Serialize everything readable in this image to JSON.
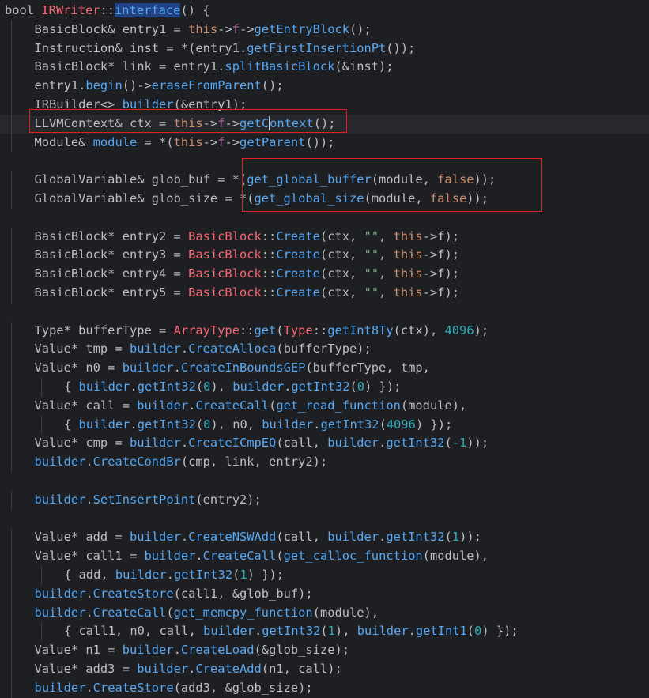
{
  "editor": {
    "lines": [
      [
        [
          "bool ",
          "ty"
        ],
        [
          "IRWriter",
          "red"
        ],
        [
          "::",
          "ty"
        ],
        [
          "interface",
          "fn sel"
        ],
        [
          "() {",
          "ty"
        ]
      ],
      [
        [
          "BasicBlock& entry1 = ",
          "ty"
        ],
        [
          "this",
          "kw"
        ],
        [
          "->",
          "ty"
        ],
        [
          "f",
          "pink"
        ],
        [
          "->",
          "ty"
        ],
        [
          "getEntryBlock",
          "fn"
        ],
        [
          "();",
          "ty"
        ]
      ],
      [
        [
          "Instruction& inst = *(entry1.",
          "ty"
        ],
        [
          "getFirstInsertionPt",
          "fn"
        ],
        [
          "());",
          "ty"
        ]
      ],
      [
        [
          "BasicBlock* link = entry1.",
          "ty"
        ],
        [
          "splitBasicBlock",
          "fn"
        ],
        [
          "(&inst);",
          "ty"
        ]
      ],
      [
        [
          "entry1.",
          "ty"
        ],
        [
          "begin",
          "fn"
        ],
        [
          "()->",
          "ty"
        ],
        [
          "eraseFromParent",
          "fn"
        ],
        [
          "();",
          "ty"
        ]
      ],
      [
        [
          "IRBuilder<> ",
          "ty"
        ],
        [
          "builder",
          "fn"
        ],
        [
          "(&entry1);",
          "ty"
        ]
      ],
      [
        [
          "LLVMContext& ctx = ",
          "ty"
        ],
        [
          "this",
          "kw"
        ],
        [
          "->",
          "ty"
        ],
        [
          "f",
          "pink"
        ],
        [
          "->",
          "ty"
        ],
        [
          "getC",
          "fn"
        ],
        [
          "ontext",
          "fn caret"
        ],
        [
          "();",
          "ty"
        ]
      ],
      [
        [
          "Module& ",
          "ty"
        ],
        [
          "module",
          "fn"
        ],
        [
          " = *(",
          "ty"
        ],
        [
          "this",
          "kw"
        ],
        [
          "->",
          "ty"
        ],
        [
          "f",
          "pink"
        ],
        [
          "->",
          "ty"
        ],
        [
          "getParent",
          "fn"
        ],
        [
          "());",
          "ty"
        ]
      ],
      [],
      [
        [
          "GlobalVariable& glob_buf = *(",
          "ty"
        ],
        [
          "get_global_buffer",
          "fn"
        ],
        [
          "(module, ",
          "ty"
        ],
        [
          "false",
          "kw"
        ],
        [
          "));",
          "ty"
        ]
      ],
      [
        [
          "GlobalVariable& glob_size = *(",
          "ty"
        ],
        [
          "get_global_size",
          "fn"
        ],
        [
          "(module, ",
          "ty"
        ],
        [
          "false",
          "kw"
        ],
        [
          "));",
          "ty"
        ]
      ],
      [],
      [
        [
          "BasicBlock* entry2 = ",
          "ty"
        ],
        [
          "BasicBlock",
          "red"
        ],
        [
          "::",
          "ty"
        ],
        [
          "Create",
          "fn"
        ],
        [
          "(ctx, ",
          "ty"
        ],
        [
          "\"\"",
          "str"
        ],
        [
          ", ",
          "ty"
        ],
        [
          "this",
          "kw"
        ],
        [
          "->f);",
          "ty"
        ]
      ],
      [
        [
          "BasicBlock* entry3 = ",
          "ty"
        ],
        [
          "BasicBlock",
          "red"
        ],
        [
          "::",
          "ty"
        ],
        [
          "Create",
          "fn"
        ],
        [
          "(ctx, ",
          "ty"
        ],
        [
          "\"\"",
          "str"
        ],
        [
          ", ",
          "ty"
        ],
        [
          "this",
          "kw"
        ],
        [
          "->f);",
          "ty"
        ]
      ],
      [
        [
          "BasicBlock* entry4 = ",
          "ty"
        ],
        [
          "BasicBlock",
          "red"
        ],
        [
          "::",
          "ty"
        ],
        [
          "Create",
          "fn"
        ],
        [
          "(ctx, ",
          "ty"
        ],
        [
          "\"\"",
          "str"
        ],
        [
          ", ",
          "ty"
        ],
        [
          "this",
          "kw"
        ],
        [
          "->f);",
          "ty"
        ]
      ],
      [
        [
          "BasicBlock* entry5 = ",
          "ty"
        ],
        [
          "BasicBlock",
          "red"
        ],
        [
          "::",
          "ty"
        ],
        [
          "Create",
          "fn"
        ],
        [
          "(ctx, ",
          "ty"
        ],
        [
          "\"\"",
          "str"
        ],
        [
          ", ",
          "ty"
        ],
        [
          "this",
          "kw"
        ],
        [
          "->f);",
          "ty"
        ]
      ],
      [],
      [
        [
          "Type* bufferType = ",
          "ty"
        ],
        [
          "ArrayType",
          "red"
        ],
        [
          "::",
          "ty"
        ],
        [
          "get",
          "fn"
        ],
        [
          "(",
          "ty"
        ],
        [
          "Type",
          "red"
        ],
        [
          "::",
          "ty"
        ],
        [
          "getInt8Ty",
          "fn"
        ],
        [
          "(ctx), ",
          "ty"
        ],
        [
          "4096",
          "num"
        ],
        [
          ");",
          "ty"
        ]
      ],
      [
        [
          "Value* tmp = ",
          "ty"
        ],
        [
          "builder",
          "fn"
        ],
        [
          ".",
          "ty"
        ],
        [
          "CreateAlloca",
          "fn"
        ],
        [
          "(bufferType);",
          "ty"
        ]
      ],
      [
        [
          "Value* n0 = ",
          "ty"
        ],
        [
          "builder",
          "fn"
        ],
        [
          ".",
          "ty"
        ],
        [
          "CreateInBoundsGEP",
          "fn"
        ],
        [
          "(bufferType, tmp,",
          "ty"
        ]
      ],
      [
        [
          "{ ",
          "ty"
        ],
        [
          "builder",
          "fn"
        ],
        [
          ".",
          "ty"
        ],
        [
          "getInt32",
          "fn"
        ],
        [
          "(",
          "ty"
        ],
        [
          "0",
          "num"
        ],
        [
          "), ",
          "ty"
        ],
        [
          "builder",
          "fn"
        ],
        [
          ".",
          "ty"
        ],
        [
          "getInt32",
          "fn"
        ],
        [
          "(",
          "ty"
        ],
        [
          "0",
          "num"
        ],
        [
          ") });",
          "ty"
        ]
      ],
      [
        [
          "Value* call = ",
          "ty"
        ],
        [
          "builder",
          "fn"
        ],
        [
          ".",
          "ty"
        ],
        [
          "CreateCall",
          "fn"
        ],
        [
          "(",
          "ty"
        ],
        [
          "get_read_function",
          "fn"
        ],
        [
          "(module),",
          "ty"
        ]
      ],
      [
        [
          "{ ",
          "ty"
        ],
        [
          "builder",
          "fn"
        ],
        [
          ".",
          "ty"
        ],
        [
          "getInt32",
          "fn"
        ],
        [
          "(",
          "ty"
        ],
        [
          "0",
          "num"
        ],
        [
          "), n0, ",
          "ty"
        ],
        [
          "builder",
          "fn"
        ],
        [
          ".",
          "ty"
        ],
        [
          "getInt32",
          "fn"
        ],
        [
          "(",
          "ty"
        ],
        [
          "4096",
          "num"
        ],
        [
          ") });",
          "ty"
        ]
      ],
      [
        [
          "Value* cmp = ",
          "ty"
        ],
        [
          "builder",
          "fn"
        ],
        [
          ".",
          "ty"
        ],
        [
          "CreateICmpEQ",
          "fn"
        ],
        [
          "(call, ",
          "ty"
        ],
        [
          "builder",
          "fn"
        ],
        [
          ".",
          "ty"
        ],
        [
          "getInt32",
          "fn"
        ],
        [
          "(",
          "ty"
        ],
        [
          "-1",
          "num"
        ],
        [
          "));",
          "ty"
        ]
      ],
      [
        [
          "builder",
          "fn"
        ],
        [
          ".",
          "ty"
        ],
        [
          "CreateCondBr",
          "fn"
        ],
        [
          "(cmp, link, entry2);",
          "ty"
        ]
      ],
      [],
      [
        [
          "builder",
          "fn"
        ],
        [
          ".",
          "ty"
        ],
        [
          "SetInsertPoint",
          "fn"
        ],
        [
          "(entry2);",
          "ty"
        ]
      ],
      [],
      [
        [
          "Value* add = ",
          "ty"
        ],
        [
          "builder",
          "fn"
        ],
        [
          ".",
          "ty"
        ],
        [
          "CreateNSWAdd",
          "fn"
        ],
        [
          "(call, ",
          "ty"
        ],
        [
          "builder",
          "fn"
        ],
        [
          ".",
          "ty"
        ],
        [
          "getInt32",
          "fn"
        ],
        [
          "(",
          "ty"
        ],
        [
          "1",
          "num"
        ],
        [
          "));",
          "ty"
        ]
      ],
      [
        [
          "Value* call1 = ",
          "ty"
        ],
        [
          "builder",
          "fn"
        ],
        [
          ".",
          "ty"
        ],
        [
          "CreateCall",
          "fn"
        ],
        [
          "(",
          "ty"
        ],
        [
          "get_calloc_function",
          "fn"
        ],
        [
          "(module),",
          "ty"
        ]
      ],
      [
        [
          "{ add, ",
          "ty"
        ],
        [
          "builder",
          "fn"
        ],
        [
          ".",
          "ty"
        ],
        [
          "getInt32",
          "fn"
        ],
        [
          "(",
          "ty"
        ],
        [
          "1",
          "num"
        ],
        [
          ") });",
          "ty"
        ]
      ],
      [
        [
          "builder",
          "fn"
        ],
        [
          ".",
          "ty"
        ],
        [
          "CreateStore",
          "fn"
        ],
        [
          "(call1, &glob_buf);",
          "ty"
        ]
      ],
      [
        [
          "builder",
          "fn"
        ],
        [
          ".",
          "ty"
        ],
        [
          "CreateCall",
          "fn"
        ],
        [
          "(",
          "ty"
        ],
        [
          "get_memcpy_function",
          "fn"
        ],
        [
          "(module),",
          "ty"
        ]
      ],
      [
        [
          "{ call1, n0, call, ",
          "ty"
        ],
        [
          "builder",
          "fn"
        ],
        [
          ".",
          "ty"
        ],
        [
          "getInt32",
          "fn"
        ],
        [
          "(",
          "ty"
        ],
        [
          "1",
          "num"
        ],
        [
          "), ",
          "ty"
        ],
        [
          "builder",
          "fn"
        ],
        [
          ".",
          "ty"
        ],
        [
          "getInt1",
          "fn"
        ],
        [
          "(",
          "ty"
        ],
        [
          "0",
          "num"
        ],
        [
          ") });",
          "ty"
        ]
      ],
      [
        [
          "Value* n1 = ",
          "ty"
        ],
        [
          "builder",
          "fn"
        ],
        [
          ".",
          "ty"
        ],
        [
          "CreateLoad",
          "fn"
        ],
        [
          "(&glob_size);",
          "ty"
        ]
      ],
      [
        [
          "Value* add3 = ",
          "ty"
        ],
        [
          "builder",
          "fn"
        ],
        [
          ".",
          "ty"
        ],
        [
          "CreateAdd",
          "fn"
        ],
        [
          "(n1, call);",
          "ty"
        ]
      ],
      [
        [
          "builder",
          "fn"
        ],
        [
          ".",
          "ty"
        ],
        [
          "CreateStore",
          "fn"
        ],
        [
          "(add3, &glob_size);",
          "ty"
        ]
      ]
    ],
    "indent_levels": [
      0,
      1,
      1,
      1,
      1,
      1,
      1,
      1,
      0,
      1,
      1,
      0,
      1,
      1,
      1,
      1,
      0,
      1,
      1,
      1,
      2,
      1,
      2,
      1,
      1,
      0,
      1,
      0,
      1,
      1,
      2,
      1,
      1,
      2,
      1,
      1,
      1
    ],
    "current_line": 6
  }
}
